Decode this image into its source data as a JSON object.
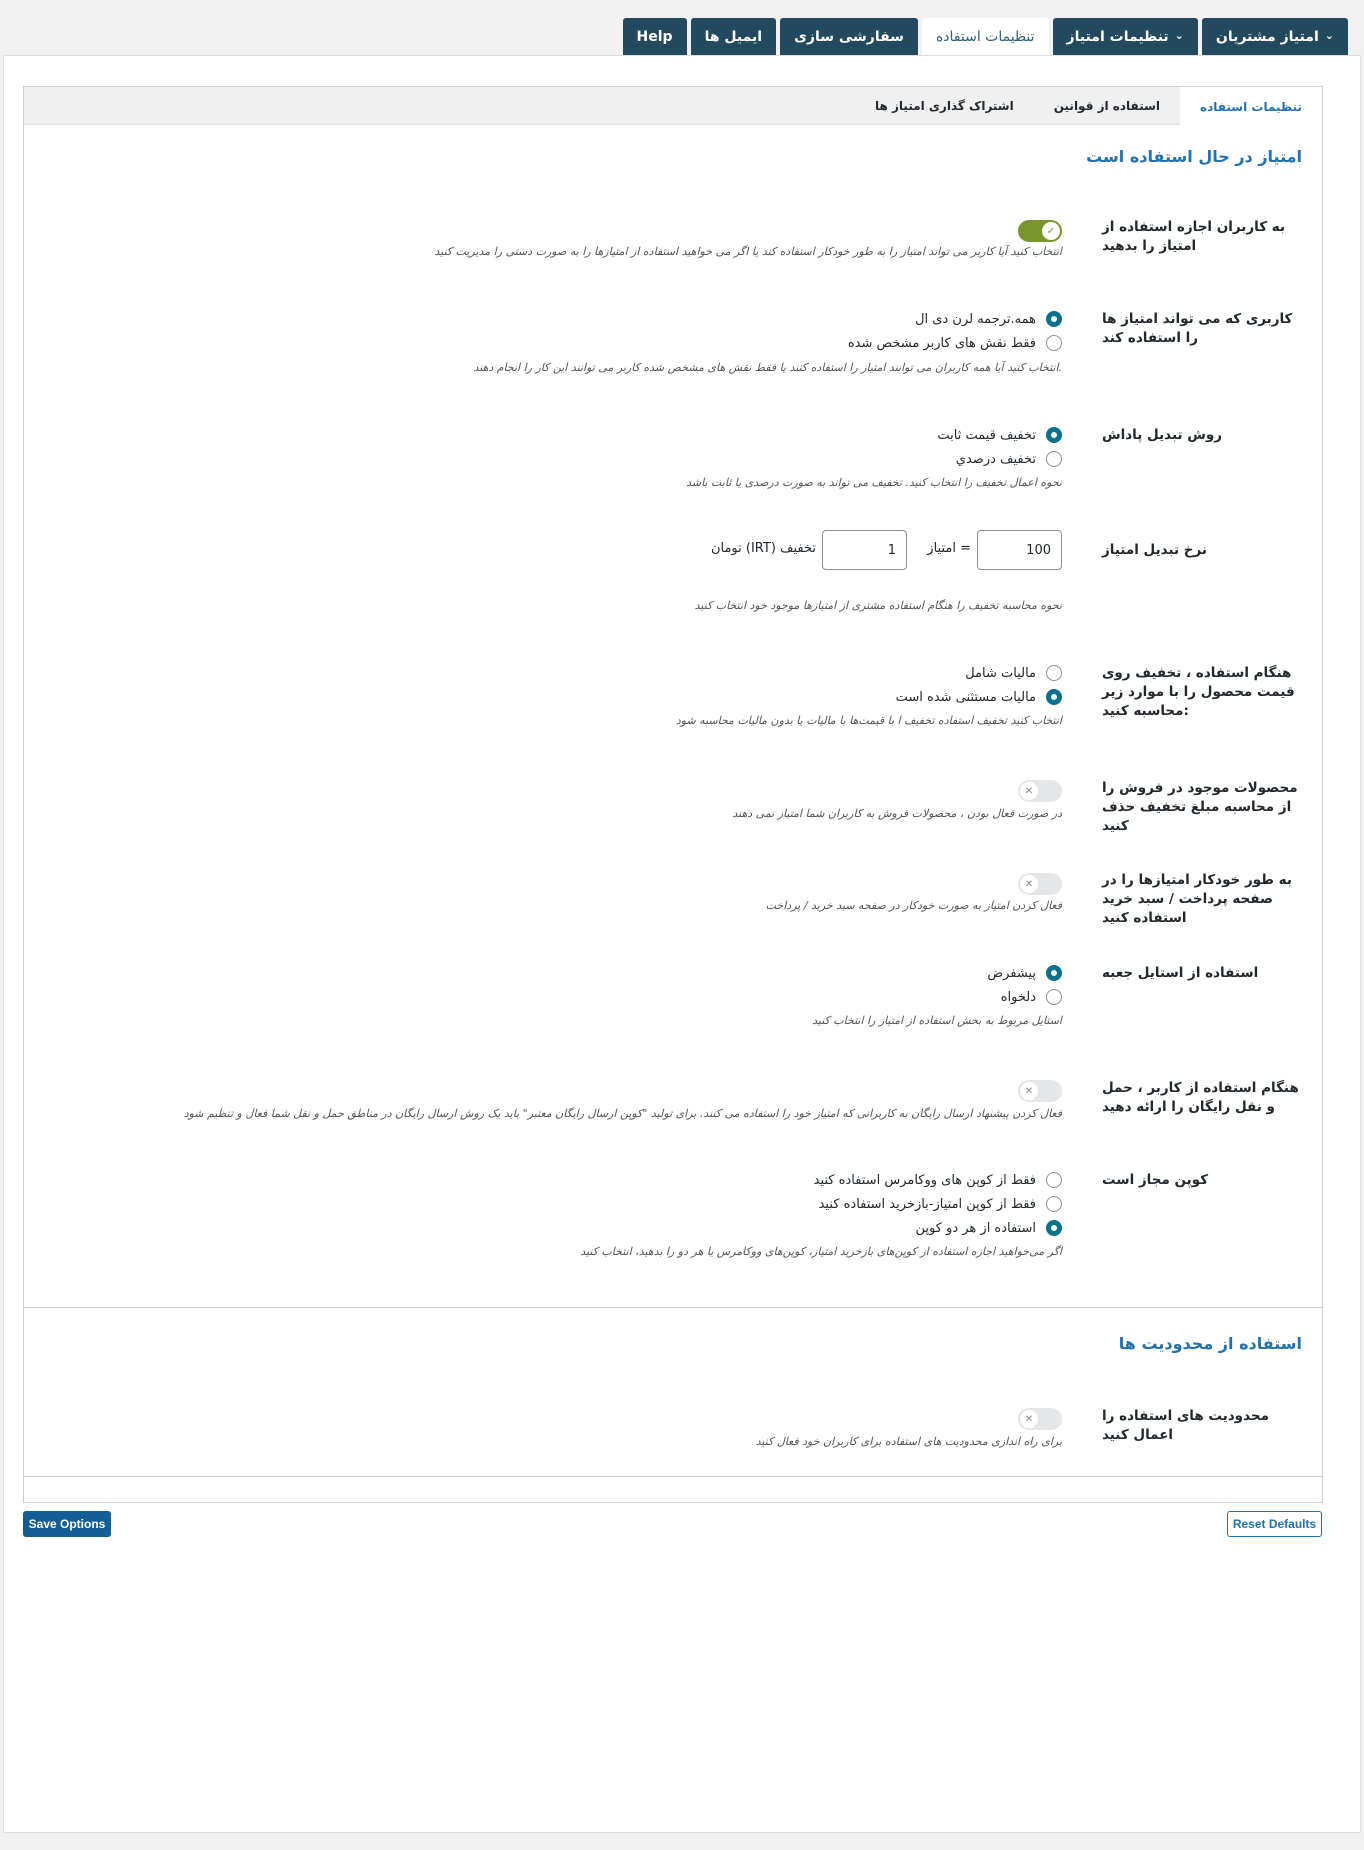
{
  "top_tabs": [
    {
      "label": "امتیاز مشتریان"
    },
    {
      "label": "تنظیمات امتیاز"
    },
    {
      "label": "تنظیمات استفاده"
    },
    {
      "label": "سفارشی سازی"
    },
    {
      "label": "ایمیل ها"
    },
    {
      "label": "Help"
    }
  ],
  "sub_tabs": [
    {
      "label": "تنظیمات استفاده"
    },
    {
      "label": "استفاده از قوانین"
    },
    {
      "label": "اشتراک گذاری امتیاز ها"
    }
  ],
  "section1_title": "امتیاز در حال استفاده است",
  "allow_redeem": {
    "label": "به کاربران اجازه استفاده از امتیاز را بدهید",
    "enabled": true,
    "desc": "انتخاب کنید آیا کاربر می تواند امتیاز را به طور خودکار استفاده کند یا اگر می خواهید استفاده از امتیازها را به صورت دستی را مدیریت کنید"
  },
  "user_scope": {
    "label": "کاربری که می تواند امتیاز ها را استفاده کند",
    "options": [
      "همه.ترجمه لرن دی ال",
      "فقط نقش های کاربر مشخص شده"
    ],
    "selected": 0,
    "desc": "انتخاب کنید آیا همه کاربران می توانند امتیاز را استفاده کنند یا فقط نقش های مشخص شده کاربر می توانند این کار را انجام دهند."
  },
  "conversion_method": {
    "label": "روش تبدیل پاداش",
    "options": [
      "تخفیف قیمت ثابت",
      "تخفیف درصدي"
    ],
    "selected": 0,
    "desc": "نحوه اعمال تخفیف را انتخاب کنید. تخفیف می تواند به صورت درصدی یا ثابت باشد"
  },
  "conversion_rate": {
    "label": "نرخ تبدیل امتیاز",
    "points_value": "100",
    "points_text": "امتیاز =",
    "discount_value": "1",
    "discount_text": "تومان (IRT) تخفیف",
    "desc": "نحوه محاسبه تخفیف را هنگام استفاده مشتری از امتیازها موجود خود انتخاب کنید"
  },
  "tax_mode": {
    "label": "هنگام استفاده ، تخفیف روی قیمت محصول را با موارد زیر محاسبه کنید:",
    "options": [
      "مالیات شامل",
      "مالیات مستثنی شده است"
    ],
    "selected": 1,
    "desc": "انتخاب کنید تخفیف استفاده تخفیف ا با قیمت‌ها با مالیات یا بدون مالیات محاسبه شود"
  },
  "exclude_on_sale": {
    "label": "محصولات موجود در فروش را از محاسبه مبلغ تخفیف حذف کنید",
    "enabled": false,
    "desc": "در صورت فعال بودن ، محصولات فروش به کاربران شما امتیاز نمی دهند"
  },
  "auto_apply": {
    "label": "به طور خودکار امتیازها را در صفحه پرداخت / سبد خرید استفاده کنید",
    "enabled": false,
    "desc": "فعال کردن امتیاز به صورت خودکار در صفحه سبد خرید / پرداخت"
  },
  "box_style": {
    "label": "استفاده از استایل جعبه",
    "options": [
      "پیشفرض",
      "دلخواه"
    ],
    "selected": 0,
    "desc": "استایل مربوط به بخش استفاده از امتیاز را انتخاب کنید"
  },
  "free_shipping": {
    "label": "هنگام استفاده از کاربر ، حمل و نقل رایگان را ارائه دهید",
    "enabled": false,
    "desc": "فعال کردن پیشنهاد ارسال رایگان به کاربرانی که امتیاز خود را استفاده می کنند. برای تولید \"کوپن ارسال رایگان معتبر\" باید یک روش ارسال رایگان در مناطق حمل و نقل شما فعال و تنظیم شود"
  },
  "coupon_allowed": {
    "label": "کوپن مجاز است",
    "options": [
      "فقط از کوپن های ووکامرس استفاده کنید",
      "فقط از کوپن امتیاز-بازخرید استفاده کنید",
      "استفاده از هر دو کوپن"
    ],
    "selected": 2,
    "desc": "اگر می‌خواهید اجازه استفاده از کوپن‌های بازخرید امتیاز، کوپن‌های ووکامرس یا هر دو را بدهید، انتخاب کنید"
  },
  "section2_title": "استفاده از محدودیت ها",
  "limits": {
    "label": "محدودیت های استفاده را اعمال کنید",
    "enabled": false,
    "desc": "برای راه اندازی محدودیت های استفاده برای کاربران خود فعال کنید"
  },
  "buttons": {
    "save": "Save Options",
    "reset": "Reset Defaults"
  },
  "colors": {
    "accent": "#2271b1",
    "tab_dark": "#23495f",
    "toggle_on": "#7a942e",
    "radio": "#0b6f8e"
  }
}
